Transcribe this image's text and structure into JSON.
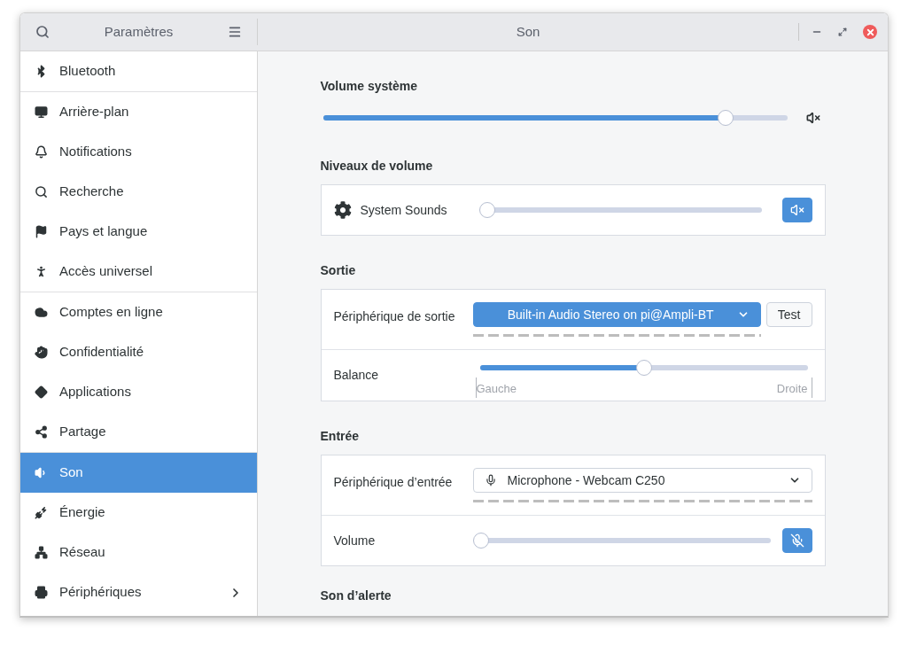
{
  "window": {
    "sidebar_title": "Paramètres",
    "title": "Son"
  },
  "sidebar": {
    "groups": [
      [
        {
          "label": "Bluetooth",
          "selected": false,
          "expandable": false
        }
      ],
      [
        {
          "label": "Arrière-plan",
          "selected": false,
          "expandable": false
        },
        {
          "label": "Notifications",
          "selected": false,
          "expandable": false
        },
        {
          "label": "Recherche",
          "selected": false,
          "expandable": false
        },
        {
          "label": "Pays et langue",
          "selected": false,
          "expandable": false
        },
        {
          "label": "Accès universel",
          "selected": false,
          "expandable": false
        }
      ],
      [
        {
          "label": "Comptes en ligne",
          "selected": false,
          "expandable": false
        },
        {
          "label": "Confidentialité",
          "selected": false,
          "expandable": false
        },
        {
          "label": "Applications",
          "selected": false,
          "expandable": false
        },
        {
          "label": "Partage",
          "selected": false,
          "expandable": false
        }
      ],
      [
        {
          "label": "Son",
          "selected": true,
          "expandable": false
        },
        {
          "label": "Énergie",
          "selected": false,
          "expandable": false
        },
        {
          "label": "Réseau",
          "selected": false,
          "expandable": false
        },
        {
          "label": "Périphériques",
          "selected": false,
          "expandable": true
        }
      ]
    ]
  },
  "system_volume": {
    "heading": "Volume système",
    "level": 0.876
  },
  "volume_levels": {
    "heading": "Niveaux de volume",
    "rows": [
      {
        "label": "System Sounds",
        "level": 0,
        "muted": true
      }
    ]
  },
  "output": {
    "heading": "Sortie",
    "device": {
      "label": "Périphérique de sortie",
      "value": "Built-in Audio Stereo on pi@Ampli-BT",
      "highlighted": true
    },
    "test_button": "Test",
    "balance": {
      "label": "Balance",
      "level": 0.5,
      "left": "Gauche",
      "right": "Droite"
    }
  },
  "input": {
    "heading": "Entrée",
    "device": {
      "label": "Périphérique d’entrée",
      "value": "Microphone - Webcam C250",
      "highlighted": false
    },
    "volume": {
      "label": "Volume",
      "level": 0,
      "muted": true
    }
  },
  "alert": {
    "heading": "Son d’alerte"
  }
}
